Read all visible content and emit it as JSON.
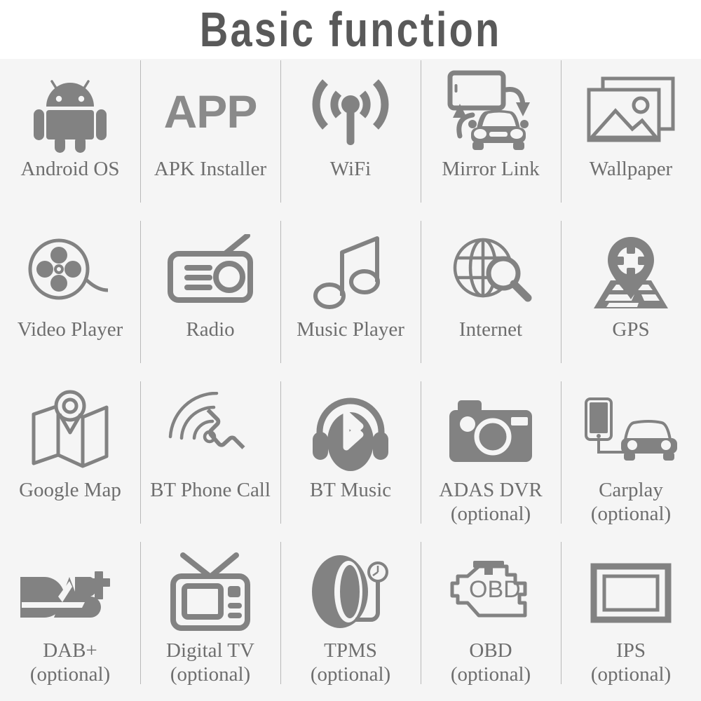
{
  "header": {
    "title": "Basic function"
  },
  "colors": {
    "page_background": "#ffffff",
    "grid_background": "#f5f5f5",
    "icon_gray": "#828282",
    "label_gray": "#6e6e6e",
    "title_gray": "#595959",
    "divider_gray": "#b9b9b9"
  },
  "grid": {
    "columns": 5,
    "rows": 4,
    "items": [
      {
        "icon": "android-robot-icon",
        "label": "Android OS",
        "sub": ""
      },
      {
        "icon": "app-wordmark-icon",
        "label": "APK Installer",
        "sub": ""
      },
      {
        "icon": "wifi-signal-icon",
        "label": "WiFi",
        "sub": ""
      },
      {
        "icon": "mirror-link-icon",
        "label": "Mirror Link",
        "sub": ""
      },
      {
        "icon": "wallpaper-photos-icon",
        "label": "Wallpaper",
        "sub": ""
      },
      {
        "icon": "film-reel-icon",
        "label": "Video Player",
        "sub": ""
      },
      {
        "icon": "radio-set-icon",
        "label": "Radio",
        "sub": ""
      },
      {
        "icon": "music-note-icon",
        "label": "Music Player",
        "sub": ""
      },
      {
        "icon": "globe-search-icon",
        "label": "Internet",
        "sub": ""
      },
      {
        "icon": "gps-pin-road-icon",
        "label": "GPS",
        "sub": ""
      },
      {
        "icon": "folded-map-pin-icon",
        "label": "Google Map",
        "sub": ""
      },
      {
        "icon": "phone-handset-icon",
        "label": "BT Phone Call",
        "sub": ""
      },
      {
        "icon": "bluetooth-headphones-icon",
        "label": "BT Music",
        "sub": ""
      },
      {
        "icon": "camera-icon",
        "label": "ADAS DVR",
        "sub": "(optional)"
      },
      {
        "icon": "phone-car-link-icon",
        "label": "Carplay",
        "sub": "(optional)"
      },
      {
        "icon": "dab-plus-wordmark-icon",
        "label": "DAB+",
        "sub": "(optional)"
      },
      {
        "icon": "television-icon",
        "label": "Digital TV",
        "sub": "(optional)"
      },
      {
        "icon": "tire-gauge-icon",
        "label": "TPMS",
        "sub": "(optional)"
      },
      {
        "icon": "engine-obd-icon",
        "label": "OBD",
        "sub": "(optional)"
      },
      {
        "icon": "ips-screen-icon",
        "label": "IPS",
        "sub": "(optional)"
      }
    ]
  },
  "icon_text": {
    "app": "APP",
    "dab": "DAB",
    "dab_plus": "+",
    "obd": "OBD"
  }
}
